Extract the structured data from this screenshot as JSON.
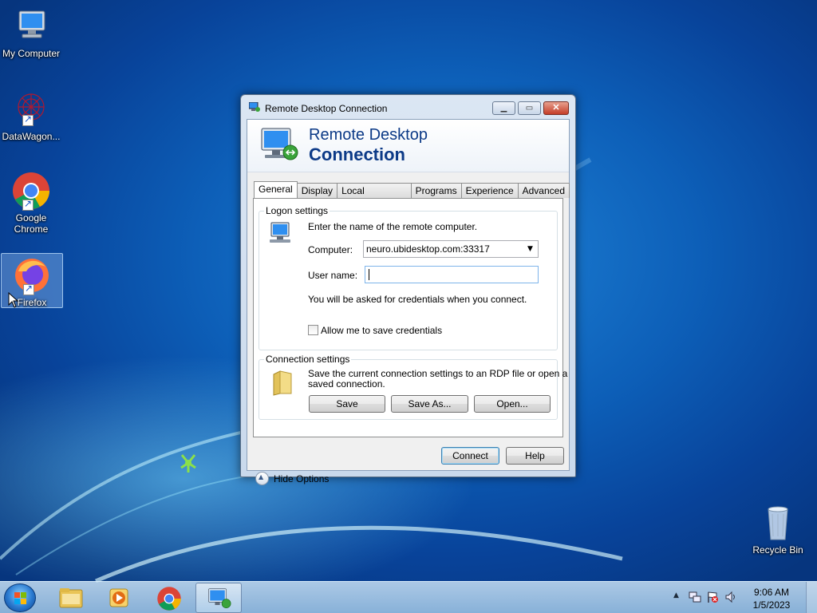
{
  "desktop": {
    "icons": [
      {
        "label": "My Computer"
      },
      {
        "label": "DataWagon..."
      },
      {
        "label": "Google Chrome"
      },
      {
        "label": "Firefox"
      },
      {
        "label": "Recycle Bin"
      }
    ]
  },
  "window": {
    "title": "Remote Desktop Connection",
    "banner_line1": "Remote Desktop",
    "banner_line2": "Connection",
    "tabs": [
      "General",
      "Display",
      "Local Resources",
      "Programs",
      "Experience",
      "Advanced"
    ],
    "active_tab": "General",
    "logon": {
      "legend": "Logon settings",
      "instruction": "Enter the name of the remote computer.",
      "computer_label": "Computer:",
      "computer_value": "neuro.ubidesktop.com:33317",
      "username_label": "User name:",
      "username_value": "",
      "credentials_note": "You will be asked for credentials when you connect.",
      "save_credentials_label": "Allow me to save credentials",
      "save_credentials_checked": false
    },
    "connection": {
      "legend": "Connection settings",
      "description_line1": "Save the current connection settings to an RDP file or open a",
      "description_line2": "saved connection.",
      "save_label": "Save",
      "save_as_label": "Save As...",
      "open_label": "Open..."
    },
    "hide_options_label": "Hide Options",
    "connect_label": "Connect",
    "help_label": "Help"
  },
  "taskbar": {
    "time": "9:06 AM",
    "date": "1/5/2023"
  }
}
